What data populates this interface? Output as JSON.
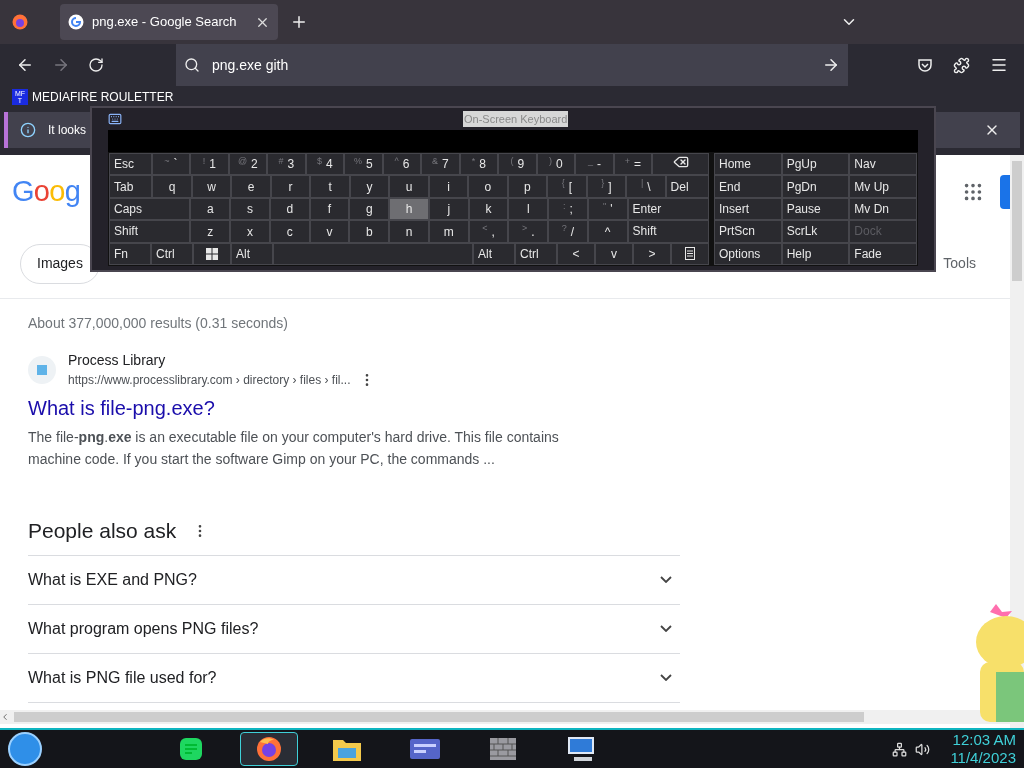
{
  "browser": {
    "tabs": [
      {
        "title": "png.exe - Google Search",
        "selected": true
      }
    ],
    "address": {
      "value": "png.exe gith"
    },
    "bookmarks": [
      {
        "badge_lines": [
          "MF",
          "T"
        ],
        "label": "MEDIAFIRE ROULETTER"
      }
    ],
    "notification": {
      "text": "It looks"
    }
  },
  "keyboard": {
    "title": "On-Screen Keyboard",
    "main_rows": [
      [
        {
          "kind": "mod",
          "label": "Esc",
          "hot": false
        },
        {
          "kind": "char",
          "shift": "~",
          "label": "`",
          "hot": false
        },
        {
          "kind": "char",
          "shift": "!",
          "label": "1",
          "hot": false
        },
        {
          "kind": "char",
          "shift": "@",
          "label": "2",
          "hot": false
        },
        {
          "kind": "char",
          "shift": "#",
          "label": "3",
          "hot": false
        },
        {
          "kind": "char",
          "shift": "$",
          "label": "4",
          "hot": false
        },
        {
          "kind": "char",
          "shift": "%",
          "label": "5",
          "hot": false
        },
        {
          "kind": "char",
          "shift": "^",
          "label": "6",
          "hot": false
        },
        {
          "kind": "char",
          "shift": "&",
          "label": "7",
          "hot": false
        },
        {
          "kind": "char",
          "shift": "*",
          "label": "8",
          "hot": false
        },
        {
          "kind": "char",
          "shift": "(",
          "label": "9",
          "hot": false
        },
        {
          "kind": "char",
          "shift": ")",
          "label": "0",
          "hot": false
        },
        {
          "kind": "char",
          "shift": "_",
          "label": "-",
          "hot": false
        },
        {
          "kind": "char",
          "shift": "+",
          "label": "=",
          "hot": false
        },
        {
          "kind": "backspace",
          "hot": false
        }
      ],
      [
        {
          "kind": "mod",
          "label": "Tab",
          "hot": false
        },
        {
          "kind": "char",
          "label": "q",
          "hot": false
        },
        {
          "kind": "char",
          "label": "w",
          "hot": false
        },
        {
          "kind": "char",
          "label": "e",
          "hot": false
        },
        {
          "kind": "char",
          "label": "r",
          "hot": false
        },
        {
          "kind": "char",
          "label": "t",
          "hot": false
        },
        {
          "kind": "char",
          "label": "y",
          "hot": false
        },
        {
          "kind": "char",
          "label": "u",
          "hot": false
        },
        {
          "kind": "char",
          "label": "i",
          "hot": false
        },
        {
          "kind": "char",
          "label": "o",
          "hot": false
        },
        {
          "kind": "char",
          "label": "p",
          "hot": false
        },
        {
          "kind": "char",
          "shift": "{",
          "label": "[",
          "hot": false
        },
        {
          "kind": "char",
          "shift": "}",
          "label": "]",
          "hot": false
        },
        {
          "kind": "char",
          "shift": "|",
          "label": "\\",
          "hot": false
        },
        {
          "kind": "mod",
          "label": "Del",
          "hot": false
        }
      ],
      [
        {
          "kind": "wide",
          "label": "Caps",
          "hot": false
        },
        {
          "kind": "char",
          "label": "a",
          "hot": false
        },
        {
          "kind": "char",
          "label": "s",
          "hot": false
        },
        {
          "kind": "char",
          "label": "d",
          "hot": false
        },
        {
          "kind": "char",
          "label": "f",
          "hot": false
        },
        {
          "kind": "char",
          "label": "g",
          "hot": false
        },
        {
          "kind": "char",
          "label": "h",
          "hot": true
        },
        {
          "kind": "char",
          "label": "j",
          "hot": false
        },
        {
          "kind": "char",
          "label": "k",
          "hot": false
        },
        {
          "kind": "char",
          "label": "l",
          "hot": false
        },
        {
          "kind": "char",
          "shift": ":",
          "label": ";",
          "hot": false
        },
        {
          "kind": "char",
          "shift": "\"",
          "label": "'",
          "hot": false
        },
        {
          "kind": "wide",
          "label": "Enter",
          "hot": false
        }
      ],
      [
        {
          "kind": "wide",
          "label": "Shift",
          "hot": false
        },
        {
          "kind": "char",
          "label": "z",
          "hot": false
        },
        {
          "kind": "char",
          "label": "x",
          "hot": false
        },
        {
          "kind": "char",
          "label": "c",
          "hot": false
        },
        {
          "kind": "char",
          "label": "v",
          "hot": false
        },
        {
          "kind": "char",
          "label": "b",
          "hot": false
        },
        {
          "kind": "char",
          "label": "n",
          "hot": false
        },
        {
          "kind": "char",
          "label": "m",
          "hot": false
        },
        {
          "kind": "char",
          "shift": "<",
          "label": ",",
          "hot": false
        },
        {
          "kind": "char",
          "shift": ">",
          "label": ".",
          "hot": false
        },
        {
          "kind": "char",
          "shift": "?",
          "label": "/",
          "hot": false
        },
        {
          "kind": "char",
          "label": "^",
          "hot": false
        },
        {
          "kind": "wide",
          "label": "Shift",
          "hot": false
        }
      ],
      [
        {
          "kind": "mod",
          "label": "Fn",
          "hot": false
        },
        {
          "kind": "mod",
          "label": "Ctrl",
          "hot": false
        },
        {
          "kind": "windows",
          "hot": false
        },
        {
          "kind": "mod",
          "label": "Alt",
          "hot": false
        },
        {
          "kind": "space",
          "hot": false
        },
        {
          "kind": "mod",
          "label": "Alt",
          "hot": false
        },
        {
          "kind": "mod",
          "label": "Ctrl",
          "hot": false
        },
        {
          "kind": "char",
          "label": "<",
          "hot": false
        },
        {
          "kind": "char",
          "label": "v",
          "hot": false
        },
        {
          "kind": "char",
          "label": ">",
          "hot": false
        },
        {
          "kind": "menu",
          "hot": false
        }
      ]
    ],
    "side_rows": [
      [
        {
          "label": "Home",
          "disabled": false
        },
        {
          "label": "PgUp",
          "disabled": false
        },
        {
          "label": "Nav",
          "disabled": false
        }
      ],
      [
        {
          "label": "End",
          "disabled": false
        },
        {
          "label": "PgDn",
          "disabled": false
        },
        {
          "label": "Mv Up",
          "disabled": false
        }
      ],
      [
        {
          "label": "Insert",
          "disabled": false
        },
        {
          "label": "Pause",
          "disabled": false
        },
        {
          "label": "Mv Dn",
          "disabled": false
        }
      ],
      [
        {
          "label": "PrtScn",
          "disabled": false
        },
        {
          "label": "ScrLk",
          "disabled": false
        },
        {
          "label": "Dock",
          "disabled": true
        }
      ],
      [
        {
          "label": "Options",
          "disabled": false
        },
        {
          "label": "Help",
          "disabled": false
        },
        {
          "label": "Fade",
          "disabled": false
        }
      ]
    ]
  },
  "google": {
    "logo": "Goog",
    "chips": [
      {
        "label": "Images"
      }
    ],
    "tools": "Tools",
    "stats": "About 377,000,000 results (0.31 seconds)",
    "result": {
      "site": "Process Library",
      "url": "https://www.processlibrary.com › directory › files › fil...",
      "title": "What is file-png.exe?",
      "snippet": "The file-**png**.**exe** is an executable file on your computer's hard drive. This file contains machine code. If you start the software Gimp on your PC, the commands ..."
    },
    "people_also_ask": {
      "title": "People also ask",
      "questions": [
        "What is EXE and PNG?",
        "What program opens PNG files?",
        "What is PNG file used for?"
      ]
    }
  },
  "taskbar": {
    "apps": [
      {
        "kind": "notes",
        "selected": false
      },
      {
        "kind": "firefox",
        "selected": true
      },
      {
        "kind": "folder",
        "selected": false
      },
      {
        "kind": "card",
        "selected": false
      },
      {
        "kind": "wall",
        "selected": false
      },
      {
        "kind": "computer",
        "selected": false
      }
    ],
    "time": "12:03 AM",
    "date": "11/4/2023"
  }
}
